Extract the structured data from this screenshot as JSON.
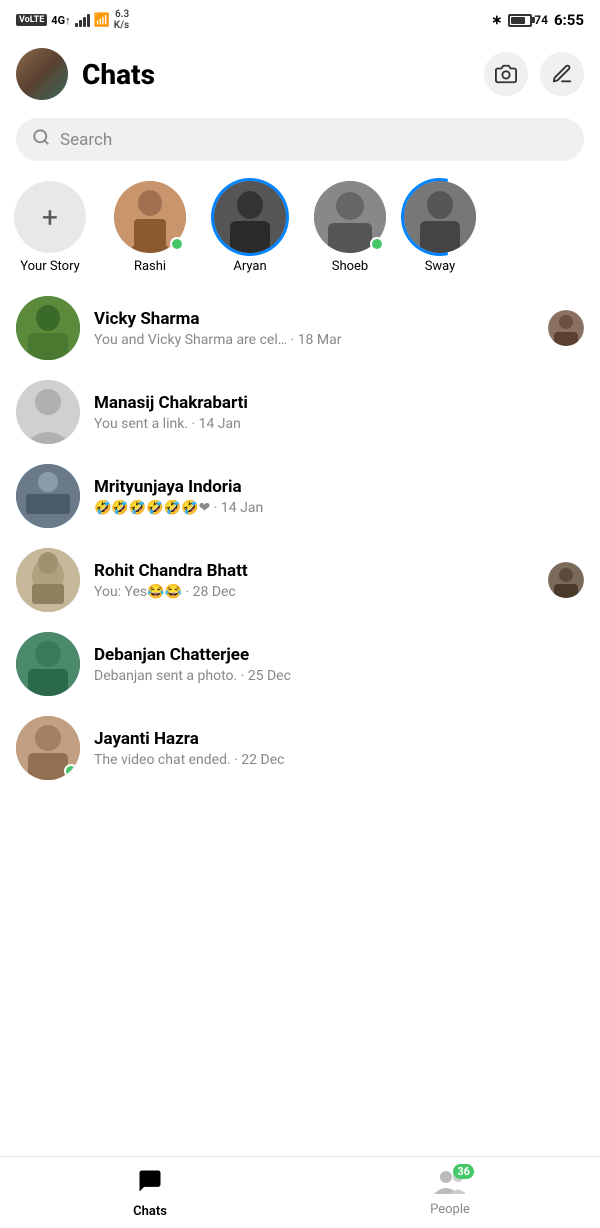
{
  "statusBar": {
    "left": {
      "volte": "VoLTE",
      "signal": "4G",
      "speed": "6.3\nK/s"
    },
    "right": {
      "battery": "74",
      "time": "6:55"
    }
  },
  "header": {
    "title": "Chats",
    "cameraBtn": "camera",
    "editBtn": "edit"
  },
  "search": {
    "placeholder": "Search"
  },
  "stories": [
    {
      "id": "your-story",
      "name": "Your Story",
      "type": "add"
    },
    {
      "id": "rashi",
      "name": "Rashi",
      "type": "normal",
      "online": true
    },
    {
      "id": "aryan",
      "name": "Aryan",
      "type": "ring-blue"
    },
    {
      "id": "shoeb",
      "name": "Shoeb",
      "type": "normal",
      "online": true
    },
    {
      "id": "sway",
      "name": "Sway",
      "type": "ring-partial"
    }
  ],
  "chats": [
    {
      "id": "vicky",
      "name": "Vicky Sharma",
      "preview": "You and Vicky Sharma are cel… · 18 Mar",
      "time": "18 Mar",
      "hasThumb": true,
      "online": false
    },
    {
      "id": "manasij",
      "name": "Manasij Chakrabarti",
      "preview": "You sent a link. · 14 Jan",
      "time": "14 Jan",
      "hasThumb": false,
      "online": false
    },
    {
      "id": "mrityunjaya",
      "name": "Mrityunjaya Indoria",
      "preview": "🤣🤣🤣🤣🤣🤣❤ · 14 Jan",
      "time": "14 Jan",
      "hasThumb": false,
      "online": false
    },
    {
      "id": "rohit",
      "name": "Rohit Chandra Bhatt",
      "preview": "You: Yes😂😂 · 28 Dec",
      "time": "28 Dec",
      "hasThumb": true,
      "online": false
    },
    {
      "id": "debanjan",
      "name": "Debanjan Chatterjee",
      "preview": "Debanjan sent a photo. · 25 Dec",
      "time": "25 Dec",
      "hasThumb": false,
      "online": false
    },
    {
      "id": "jayanti",
      "name": "Jayanti Hazra",
      "preview": "The video chat ended. · 22 Dec",
      "time": "22 Dec",
      "hasThumb": false,
      "online": true
    }
  ],
  "bottomNav": {
    "chats": {
      "label": "Chats",
      "active": true
    },
    "people": {
      "label": "People",
      "count": "36",
      "active": false
    }
  }
}
